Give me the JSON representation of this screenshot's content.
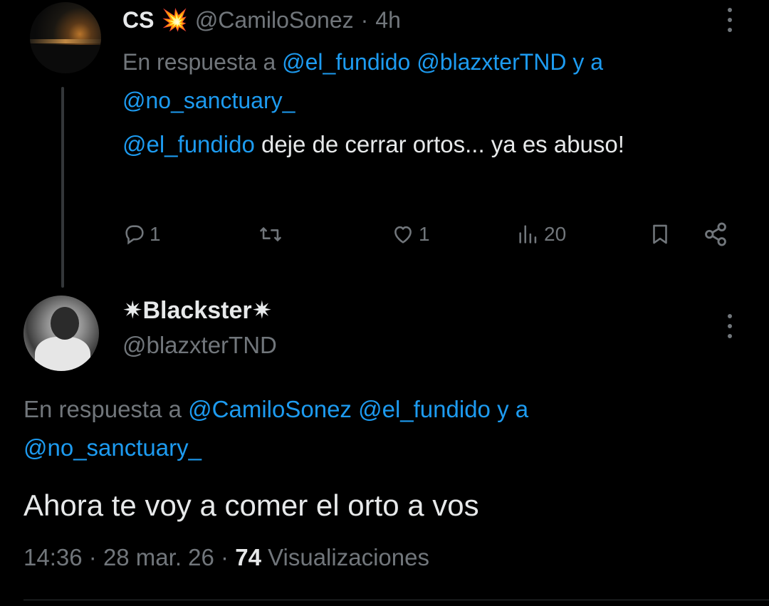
{
  "reply_tweet": {
    "display_name": "CS",
    "name_emoji": "💥",
    "handle": "@CamiloSonez",
    "separator": "·",
    "time": "4h",
    "reply_prefix": "En respuesta a",
    "reply_mention_1": "@el_fundido",
    "reply_mention_2": "@blazxterTND",
    "reply_conj": "y a",
    "reply_mention_3": "@no_sanctuary_",
    "text_mention": "@el_fundido",
    "text_body": " deje de cerrar ortos... ya es abuso!",
    "stats": {
      "replies": "1",
      "reposts": "",
      "likes": "1",
      "views": "20"
    }
  },
  "main_tweet": {
    "display_name": "✷Blackster✷",
    "handle": "@blazxterTND",
    "reply_prefix": "En respuesta a",
    "reply_mention_1": "@CamiloSonez",
    "reply_mention_2": "@el_fundido",
    "reply_conj": "y a",
    "reply_mention_3": "@no_sanctuary_",
    "text": "Ahora te voy a comer el orto a vos",
    "time": "14:36",
    "sep1": "·",
    "date": "28 mar. 26",
    "sep2": "·",
    "views_count": "74",
    "views_label": "Visualizaciones"
  },
  "colors": {
    "background": "#000000",
    "text": "#e7e9ea",
    "muted": "#71767b",
    "link": "#1d9bf0"
  },
  "icons": [
    "more-icon",
    "reply-icon",
    "repost-icon",
    "like-icon",
    "views-icon",
    "bookmark-icon",
    "share-icon"
  ]
}
